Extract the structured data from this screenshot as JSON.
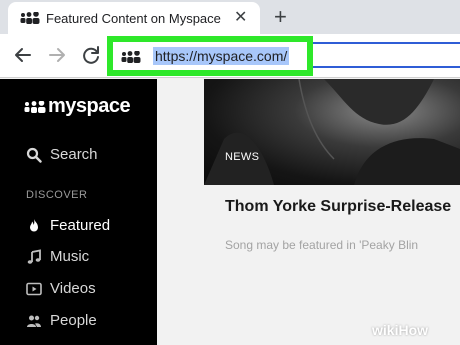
{
  "browser": {
    "tab": {
      "title": "Featured Content on Myspace",
      "close_glyph": "✕"
    },
    "new_tab_glyph": "+",
    "nav": {
      "back_icon": "arrow-left-icon",
      "forward_icon": "arrow-right-icon",
      "reload_icon": "reload-icon"
    },
    "address_bar": {
      "url": "https://myspace.com/",
      "highlight_color": "#2ee82a",
      "focus_color": "#2f5dd6"
    }
  },
  "sidebar": {
    "logo_text": "myspace",
    "search_label": "Search",
    "section_label": "DISCOVER",
    "items": [
      {
        "label": "Featured",
        "icon": "flame-icon",
        "active": true
      },
      {
        "label": "Music",
        "icon": "music-note-icon",
        "active": false
      },
      {
        "label": "Videos",
        "icon": "video-icon",
        "active": false
      },
      {
        "label": "People",
        "icon": "people-icon",
        "active": false
      }
    ]
  },
  "main": {
    "badge": "NEWS",
    "article_title": "Thom Yorke Surprise-Release",
    "article_sub": "Song may be featured in 'Peaky Blin"
  },
  "watermark": "wikiHow"
}
